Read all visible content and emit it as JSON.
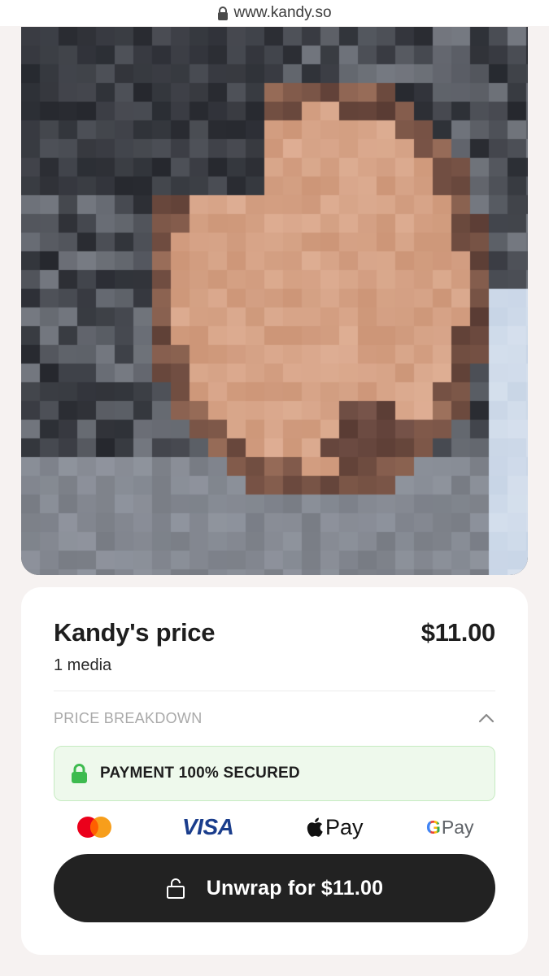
{
  "browser": {
    "url": "www.kandy.so",
    "lock_icon": "lock-icon"
  },
  "media": {
    "description_icon": "blurred-media-preview"
  },
  "purchase": {
    "title": "Kandy's price",
    "price": "$11.00",
    "media_count": "1 media",
    "breakdown_label": "PRICE BREAKDOWN",
    "secured_label": "PAYMENT 100% SECURED",
    "unwrap_label": "Unwrap for $11.00"
  },
  "payment_methods": {
    "visa": "VISA",
    "apple_pay": "Pay",
    "google_pay_g": "G",
    "google_pay": "Pay"
  },
  "colors": {
    "page_bg": "#f6f2f1",
    "card_bg": "#ffffff",
    "button_bg": "#222222",
    "secured_bg": "#eef9ec",
    "secured_border": "#c6ebc1",
    "lock_green": "#3dbb4f",
    "visa_blue": "#1a3d8c",
    "mastercard_red": "#eb001b",
    "mastercard_orange": "#f79e1b"
  }
}
